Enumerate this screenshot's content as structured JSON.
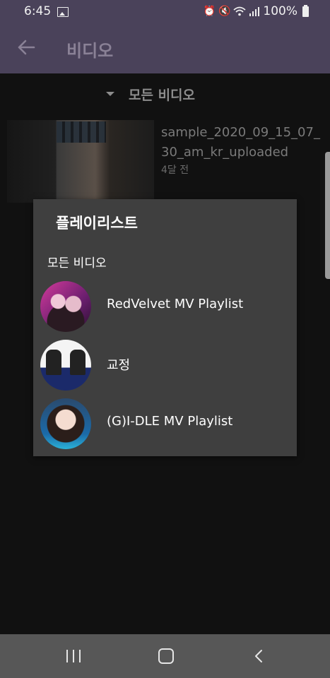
{
  "status_bar": {
    "time": "6:45",
    "battery_text": "100%",
    "icons": [
      "image-icon",
      "alarm-icon",
      "mute-icon",
      "wifi-icon",
      "signal-icon",
      "battery-icon"
    ]
  },
  "app_bar": {
    "title": "비디오",
    "back_icon": "arrow-left-icon"
  },
  "filter": {
    "label": "모든 비디오",
    "icon": "caret-down-icon"
  },
  "video_list": [
    {
      "title": "sample_2020_09_15_07_30_am_kr_uploaded",
      "age": "4달 전"
    }
  ],
  "dialog": {
    "title": "플레이리스트",
    "all_videos_label": "모든 비디오",
    "playlists": [
      {
        "label": "RedVelvet MV Playlist"
      },
      {
        "label": "교정"
      },
      {
        "label": "(G)I-DLE MV Playlist"
      }
    ]
  },
  "colors": {
    "app_bar_bg": "#4a425a",
    "dialog_bg": "#3f3f3f",
    "nav_bar_bg": "#575757"
  },
  "nav_bar": {
    "icons": [
      "recent-apps-icon",
      "home-icon",
      "back-icon"
    ]
  }
}
